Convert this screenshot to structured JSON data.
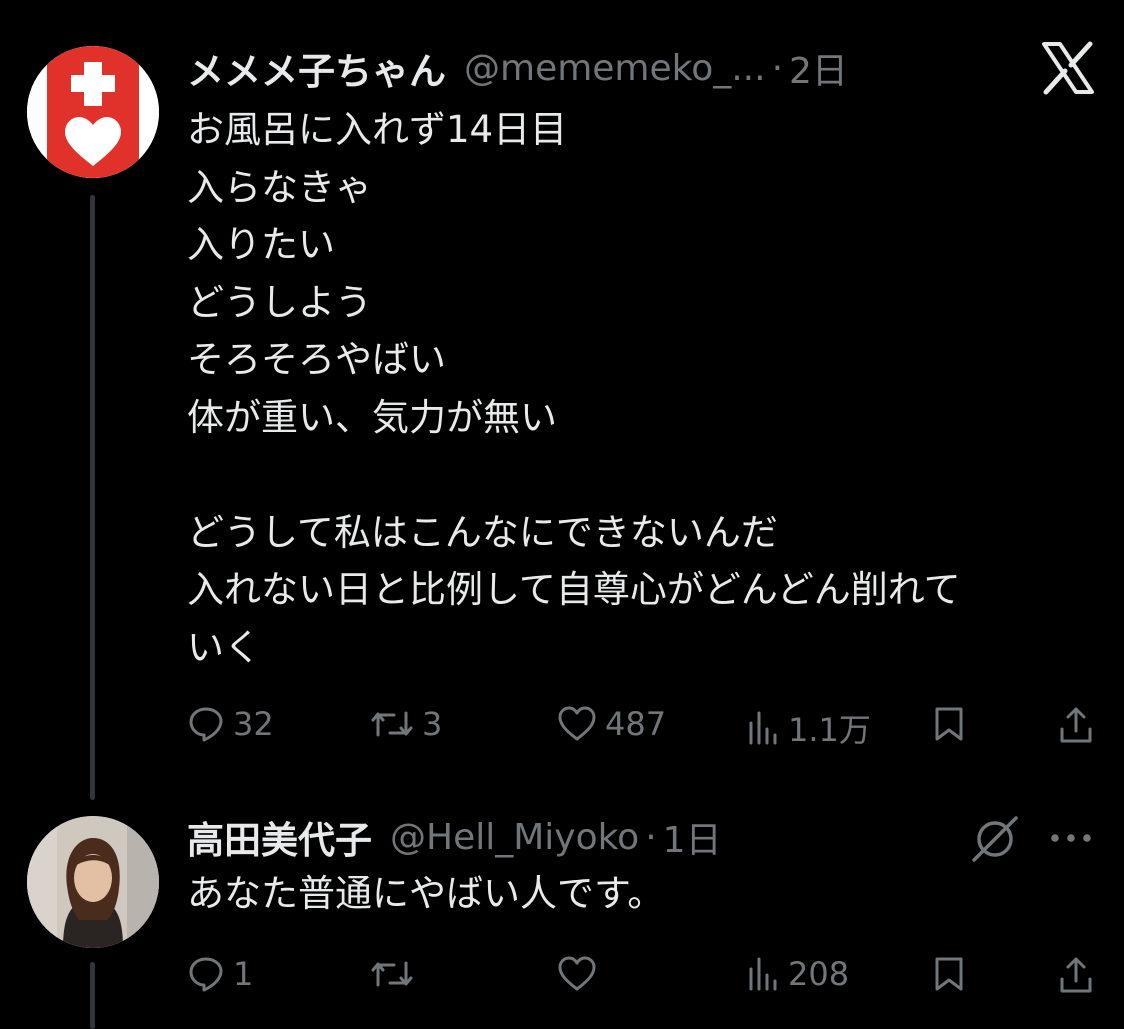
{
  "tweets": [
    {
      "display_name": "メメメ子ちゃん",
      "handle": "@mememeko_...",
      "time": "2日",
      "lines": [
        "お風呂に入れず14日目",
        "入らなきゃ",
        "入りたい",
        "どうしよう",
        "そろそろやばい",
        "体が重い、気力が無い",
        "",
        "どうして私はこんなにできないんだ",
        "入れない日と比例して自尊心がどんどん削れて",
        "いく"
      ],
      "stats": {
        "replies": "32",
        "retweets": "3",
        "likes": "487",
        "views": "1.1万"
      }
    },
    {
      "display_name": "高田美代子",
      "handle": "@Hell_Miyoko",
      "time": "1日",
      "lines": [
        "あなた普通にやばい人です。"
      ],
      "stats": {
        "replies": "1",
        "retweets": "",
        "likes": "",
        "views": "208"
      }
    }
  ],
  "icons": {
    "top_right": "x-logo-icon",
    "reply_menu": [
      "grok-icon",
      "more-icon"
    ],
    "actions": [
      "reply-icon",
      "retweet-icon",
      "like-icon",
      "views-icon",
      "bookmark-icon",
      "share-icon"
    ]
  },
  "colors": {
    "background": "#000000",
    "text": "#e7e9ea",
    "secondary": "#71767b",
    "thread_line": "#333639",
    "avatar_red": "#e0322b"
  }
}
